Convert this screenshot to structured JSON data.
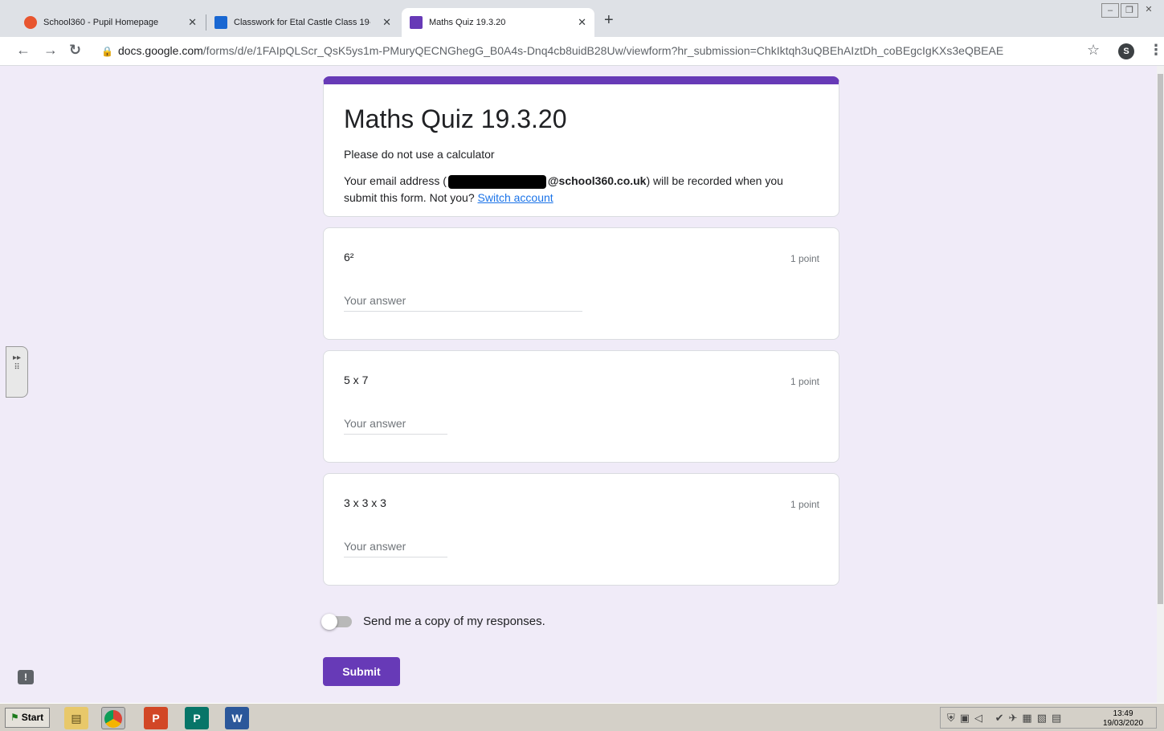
{
  "browser": {
    "tabs": [
      {
        "title": "School360 - Pupil Homepage",
        "favicon_color": "#e8552f"
      },
      {
        "title": "Classwork for Etal Castle Class 19-20",
        "favicon_color": "#1967d2"
      },
      {
        "title": "Maths Quiz 19.3.20",
        "favicon_color": "#673ab7"
      }
    ],
    "url_host": "docs.google.com",
    "url_path": "/forms/d/e/1FAIpQLScr_QsK5ys1m-PMuryQECNGhegG_B0A4s-Dnq4cb8uidB28Uw/viewform?hr_submission=ChkIktqh3uQBEhAIztDh_coBEgcIgKXs3eQBEAE",
    "profile_initial": "S"
  },
  "form": {
    "title": "Maths Quiz 19.3.20",
    "description": "Please do not use a calculator",
    "email_prefix": "Your email address (",
    "email_domain": "@school360.co.uk",
    "email_suffix": ") will be recorded when you submit this form. Not you?",
    "switch_account": "Switch account",
    "accent_color": "#673ab7",
    "questions": [
      {
        "text": "6²",
        "points": "1 point",
        "placeholder": "Your answer"
      },
      {
        "text": "5 x 7",
        "points": "1 point",
        "placeholder": "Your answer"
      },
      {
        "text": "3 x 3 x 3",
        "points": "1 point",
        "placeholder": "Your answer"
      }
    ],
    "send_copy_label": "Send me a copy of my responses.",
    "send_copy_enabled": false,
    "submit_label": "Submit"
  },
  "taskbar": {
    "start_label": "Start",
    "time": "13:49",
    "date": "19/03/2020"
  }
}
